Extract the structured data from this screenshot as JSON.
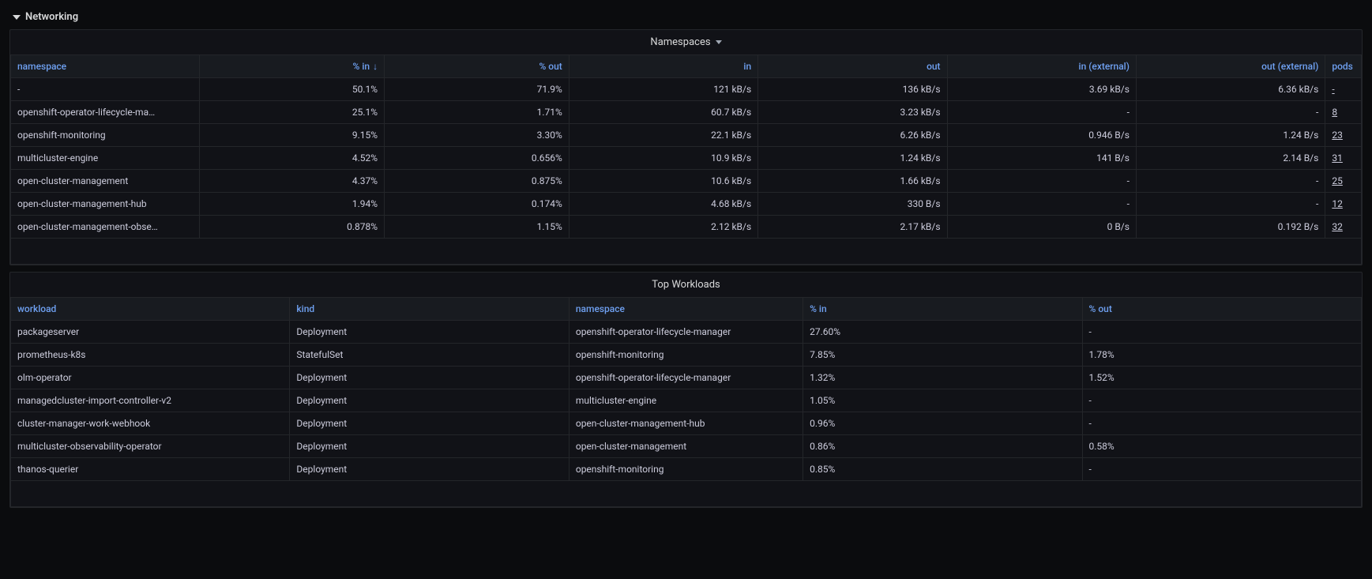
{
  "section": {
    "title": "Networking"
  },
  "panel_ns": {
    "title": "Namespaces",
    "columns": {
      "namespace": "namespace",
      "pct_in": "% in",
      "pct_out": "% out",
      "in": "in",
      "out": "out",
      "in_ext": "in (external)",
      "out_ext": "out (external)",
      "pods": "pods"
    },
    "sort_indicator": "↓",
    "rows": [
      {
        "namespace": "-",
        "pct_in": "50.1%",
        "pct_out": "71.9%",
        "in": "121 kB/s",
        "out": "136 kB/s",
        "in_ext": "3.69 kB/s",
        "out_ext": "6.36 kB/s",
        "pods": "-"
      },
      {
        "namespace": "openshift-operator-lifecycle-ma…",
        "pct_in": "25.1%",
        "pct_out": "1.71%",
        "in": "60.7 kB/s",
        "out": "3.23 kB/s",
        "in_ext": "-",
        "out_ext": "-",
        "pods": "8"
      },
      {
        "namespace": "openshift-monitoring",
        "pct_in": "9.15%",
        "pct_out": "3.30%",
        "in": "22.1 kB/s",
        "out": "6.26 kB/s",
        "in_ext": "0.946 B/s",
        "out_ext": "1.24 B/s",
        "pods": "23"
      },
      {
        "namespace": "multicluster-engine",
        "pct_in": "4.52%",
        "pct_out": "0.656%",
        "in": "10.9 kB/s",
        "out": "1.24 kB/s",
        "in_ext": "141 B/s",
        "out_ext": "2.14 B/s",
        "pods": "31"
      },
      {
        "namespace": "open-cluster-management",
        "pct_in": "4.37%",
        "pct_out": "0.875%",
        "in": "10.6 kB/s",
        "out": "1.66 kB/s",
        "in_ext": "-",
        "out_ext": "-",
        "pods": "25"
      },
      {
        "namespace": "open-cluster-management-hub",
        "pct_in": "1.94%",
        "pct_out": "0.174%",
        "in": "4.68 kB/s",
        "out": "330 B/s",
        "in_ext": "-",
        "out_ext": "-",
        "pods": "12"
      },
      {
        "namespace": "open-cluster-management-obse…",
        "pct_in": "0.878%",
        "pct_out": "1.15%",
        "in": "2.12 kB/s",
        "out": "2.17 kB/s",
        "in_ext": "0 B/s",
        "out_ext": "0.192 B/s",
        "pods": "32"
      }
    ]
  },
  "panel_wl": {
    "title": "Top Workloads",
    "columns": {
      "workload": "workload",
      "kind": "kind",
      "namespace": "namespace",
      "pct_in": "% in",
      "pct_out": "% out"
    },
    "rows": [
      {
        "workload": "packageserver",
        "kind": "Deployment",
        "namespace": "openshift-operator-lifecycle-manager",
        "pct_in": "27.60%",
        "pct_out": "-"
      },
      {
        "workload": "prometheus-k8s",
        "kind": "StatefulSet",
        "namespace": "openshift-monitoring",
        "pct_in": "7.85%",
        "pct_out": "1.78%"
      },
      {
        "workload": "olm-operator",
        "kind": "Deployment",
        "namespace": "openshift-operator-lifecycle-manager",
        "pct_in": "1.32%",
        "pct_out": "1.52%"
      },
      {
        "workload": "managedcluster-import-controller-v2",
        "kind": "Deployment",
        "namespace": "multicluster-engine",
        "pct_in": "1.05%",
        "pct_out": "-"
      },
      {
        "workload": "cluster-manager-work-webhook",
        "kind": "Deployment",
        "namespace": "open-cluster-management-hub",
        "pct_in": "0.96%",
        "pct_out": "-"
      },
      {
        "workload": "multicluster-observability-operator",
        "kind": "Deployment",
        "namespace": "open-cluster-management",
        "pct_in": "0.86%",
        "pct_out": "0.58%"
      },
      {
        "workload": "thanos-querier",
        "kind": "Deployment",
        "namespace": "openshift-monitoring",
        "pct_in": "0.85%",
        "pct_out": "-"
      }
    ]
  }
}
